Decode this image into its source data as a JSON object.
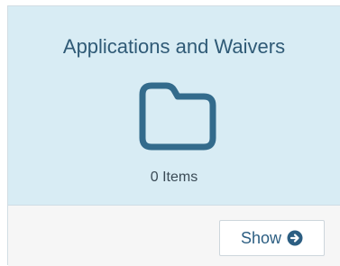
{
  "card": {
    "title": "Applications and Waivers",
    "count_text": "0 Items",
    "icon": "folder-icon"
  },
  "footer": {
    "show_label": "Show",
    "show_icon": "arrow-circle-right-icon"
  },
  "colors": {
    "body_background": "#d8ecf4",
    "title_color": "#2f5a76",
    "icon_color": "#336b8c",
    "footer_background": "#f6f6f6",
    "button_text_color": "#2c5e82"
  }
}
